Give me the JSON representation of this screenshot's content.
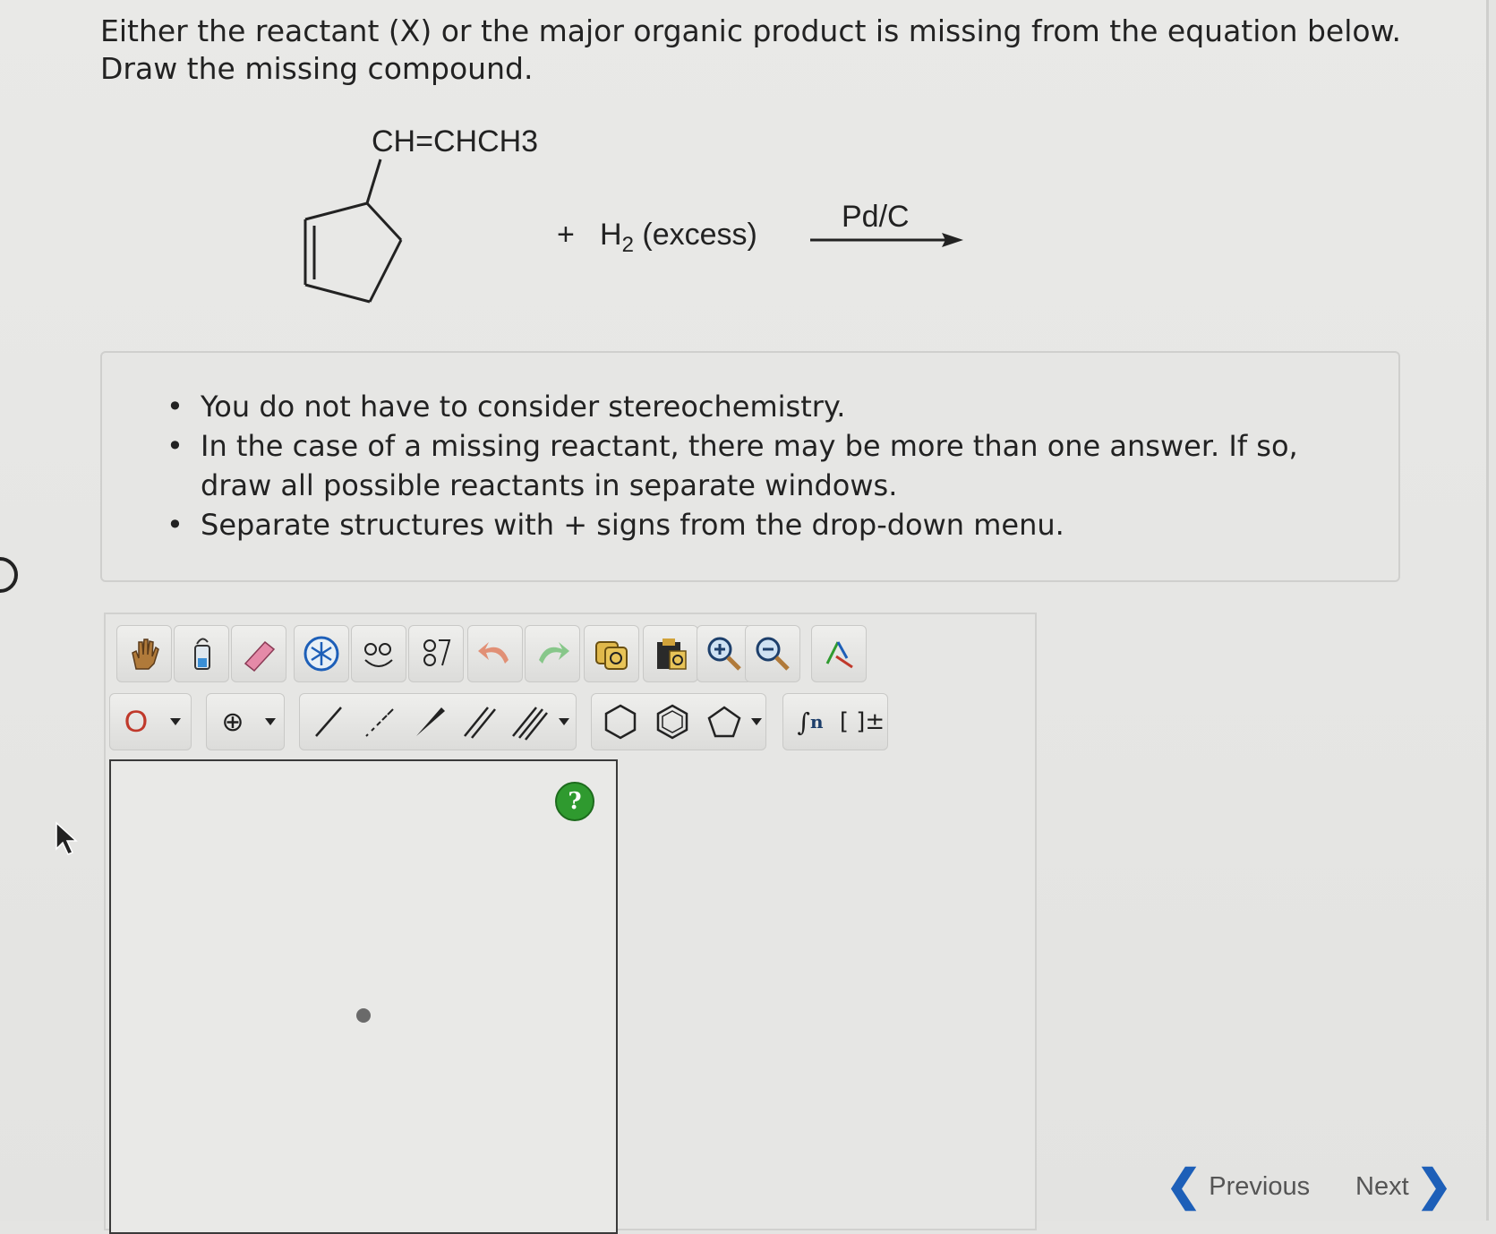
{
  "question": "Either the reactant (X) or the major organic product is missing from the equation below. Draw the missing compound.",
  "reaction": {
    "substituent": "CH=CHCH3",
    "plus": "+",
    "reagent": "H",
    "reagent_sub": "2",
    "reagent_note": "(excess)",
    "catalyst": "Pd/C"
  },
  "instructions": [
    "You do not have to consider stereochemistry.",
    "In the case of a missing reactant, there may be more than one answer. If so, draw all possible reactants in separate windows.",
    "Separate structures with + signs from the drop-down menu."
  ],
  "toolbar": {
    "top_tools": [
      "hand-icon",
      "template-flask-icon",
      "eraser-icon",
      "atom-ring-icon",
      "clean-structure-icon",
      "chain-icon",
      "undo-icon",
      "redo-icon",
      "copy-icon",
      "paste-icon",
      "zoom-in-icon",
      "zoom-out-icon",
      "color-icon"
    ],
    "atom_label": "O",
    "charge_label": "⊕",
    "bracket_label": "[ ]±",
    "polymer_label": "n"
  },
  "help_label": "?",
  "nav": {
    "previous": "Previous",
    "next": "Next"
  },
  "colors": {
    "accent_blue": "#1d5fb8",
    "help_green": "#2f9a2f",
    "atom_red": "#c0392b"
  }
}
